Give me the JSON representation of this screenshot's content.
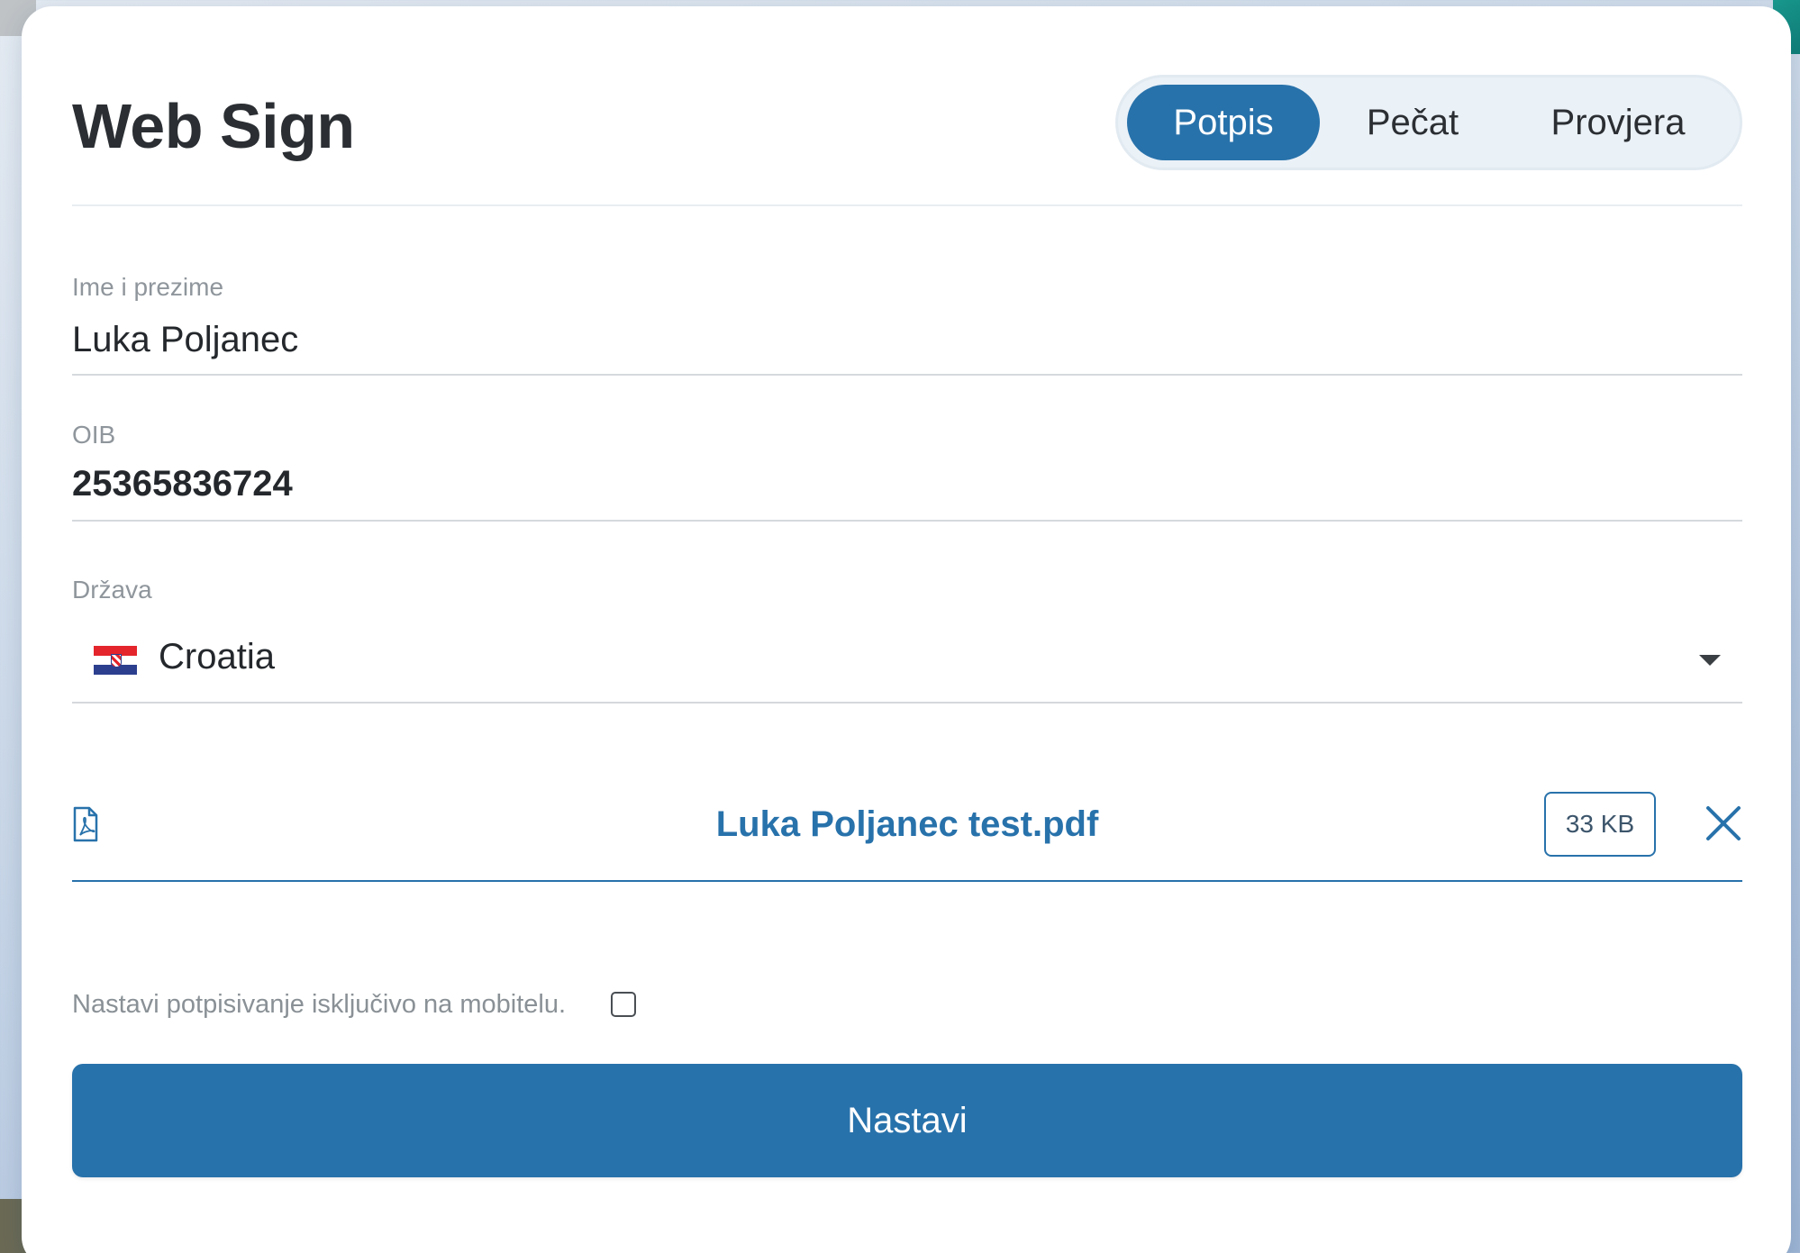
{
  "app": {
    "title": "Web Sign"
  },
  "tabs": [
    {
      "label": "Potpis",
      "active": true
    },
    {
      "label": "Pečat",
      "active": false
    },
    {
      "label": "Provjera",
      "active": false
    }
  ],
  "form": {
    "name": {
      "label": "Ime i prezime",
      "value": "Luka Poljanec"
    },
    "oib": {
      "label": "OIB",
      "value": "25365836724"
    },
    "country": {
      "label": "Država",
      "value": "Croatia",
      "flag_icon": "croatia-flag-icon"
    }
  },
  "file": {
    "icon": "pdf-file-icon",
    "name": "Luka Poljanec test.pdf",
    "size": "33 KB",
    "remove_icon": "close-icon"
  },
  "mobile_option": {
    "label": "Nastavi potpisivanje isključivo na mobitelu.",
    "checked": false
  },
  "submit": {
    "label": "Nastavi"
  },
  "colors": {
    "accent": "#2872ab",
    "text": "#24282c",
    "muted": "#8f969c"
  }
}
